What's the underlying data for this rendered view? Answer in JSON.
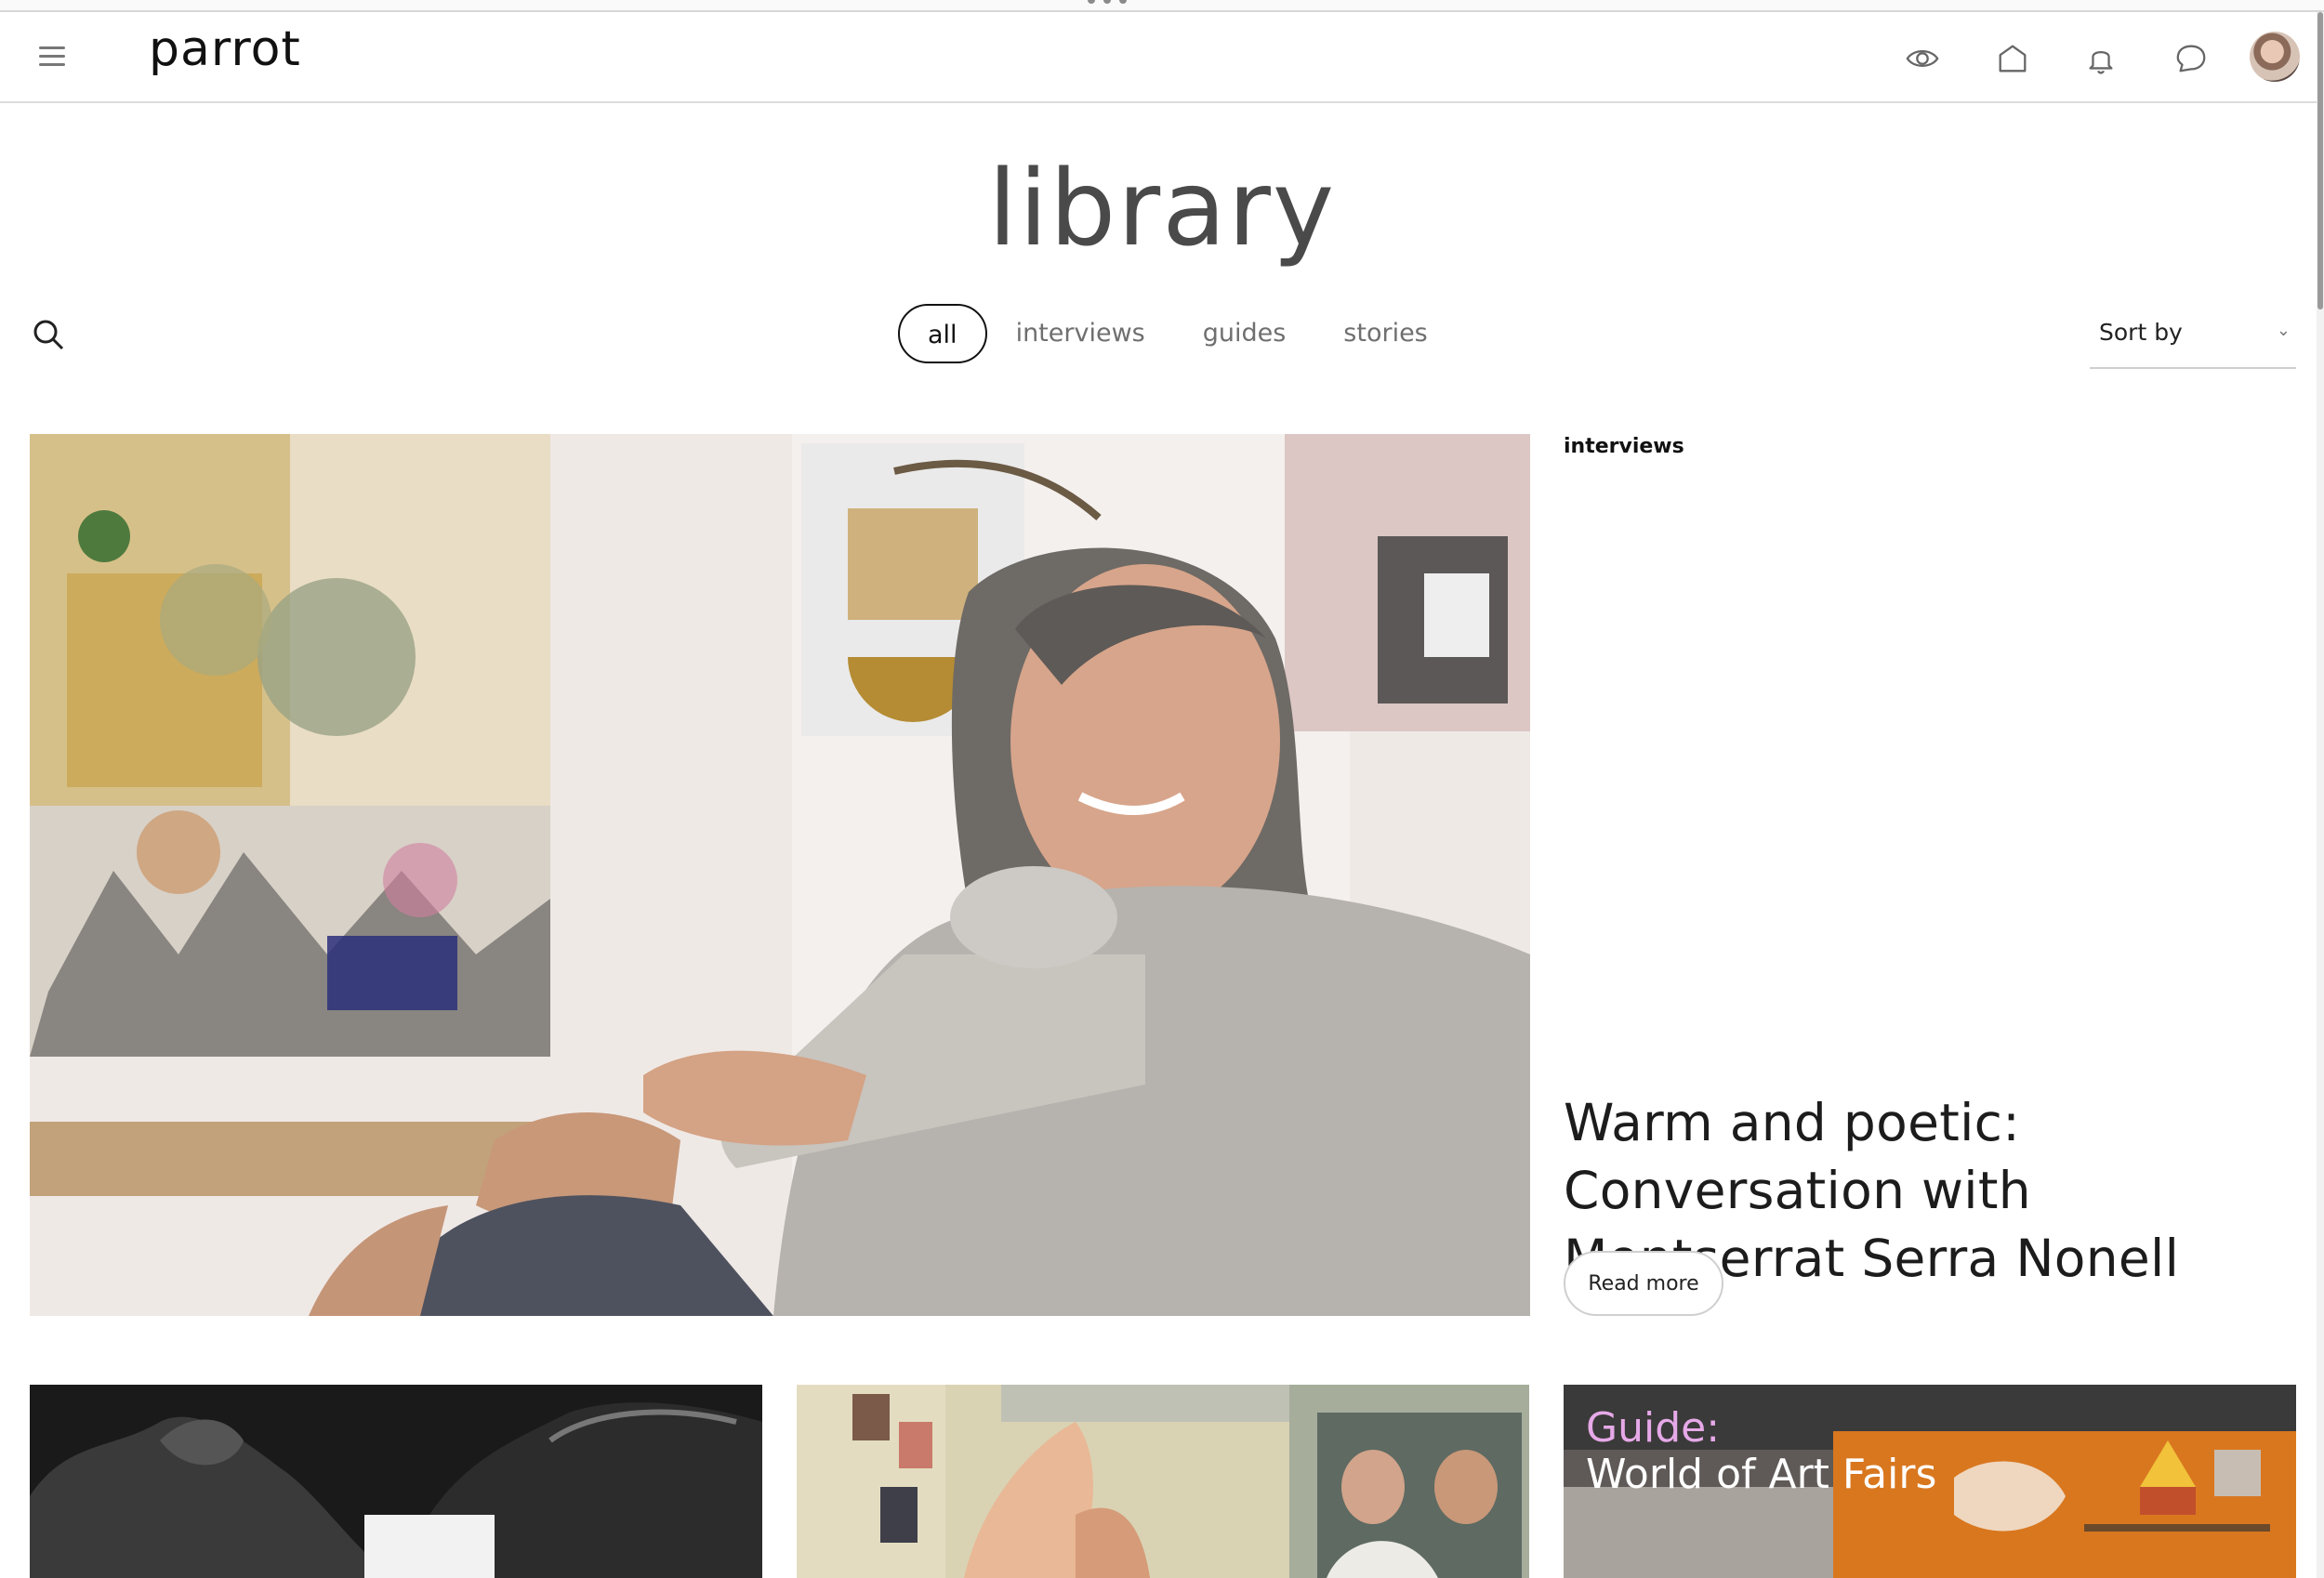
{
  "header": {
    "logo": "parrot",
    "icons": [
      "eye-icon",
      "home-icon",
      "bell-icon",
      "chat-icon"
    ]
  },
  "page": {
    "title": "library"
  },
  "filters": {
    "tabs": [
      {
        "label": "all",
        "active": true
      },
      {
        "label": "interviews",
        "active": false
      },
      {
        "label": "guides",
        "active": false
      },
      {
        "label": "stories",
        "active": false
      }
    ],
    "sort_label": "Sort by"
  },
  "featured": {
    "category": "interviews",
    "title": "Warm and poetic: Conversation with Montserrat Serra Nonell",
    "cta": "Read more"
  },
  "cards": [
    {
      "kind": "photo"
    },
    {
      "kind": "painting"
    },
    {
      "kind": "guide",
      "label_prefix": "Guide:",
      "label_title": "World of Art Fairs",
      "prefix_color": "#e6a9e8"
    }
  ]
}
